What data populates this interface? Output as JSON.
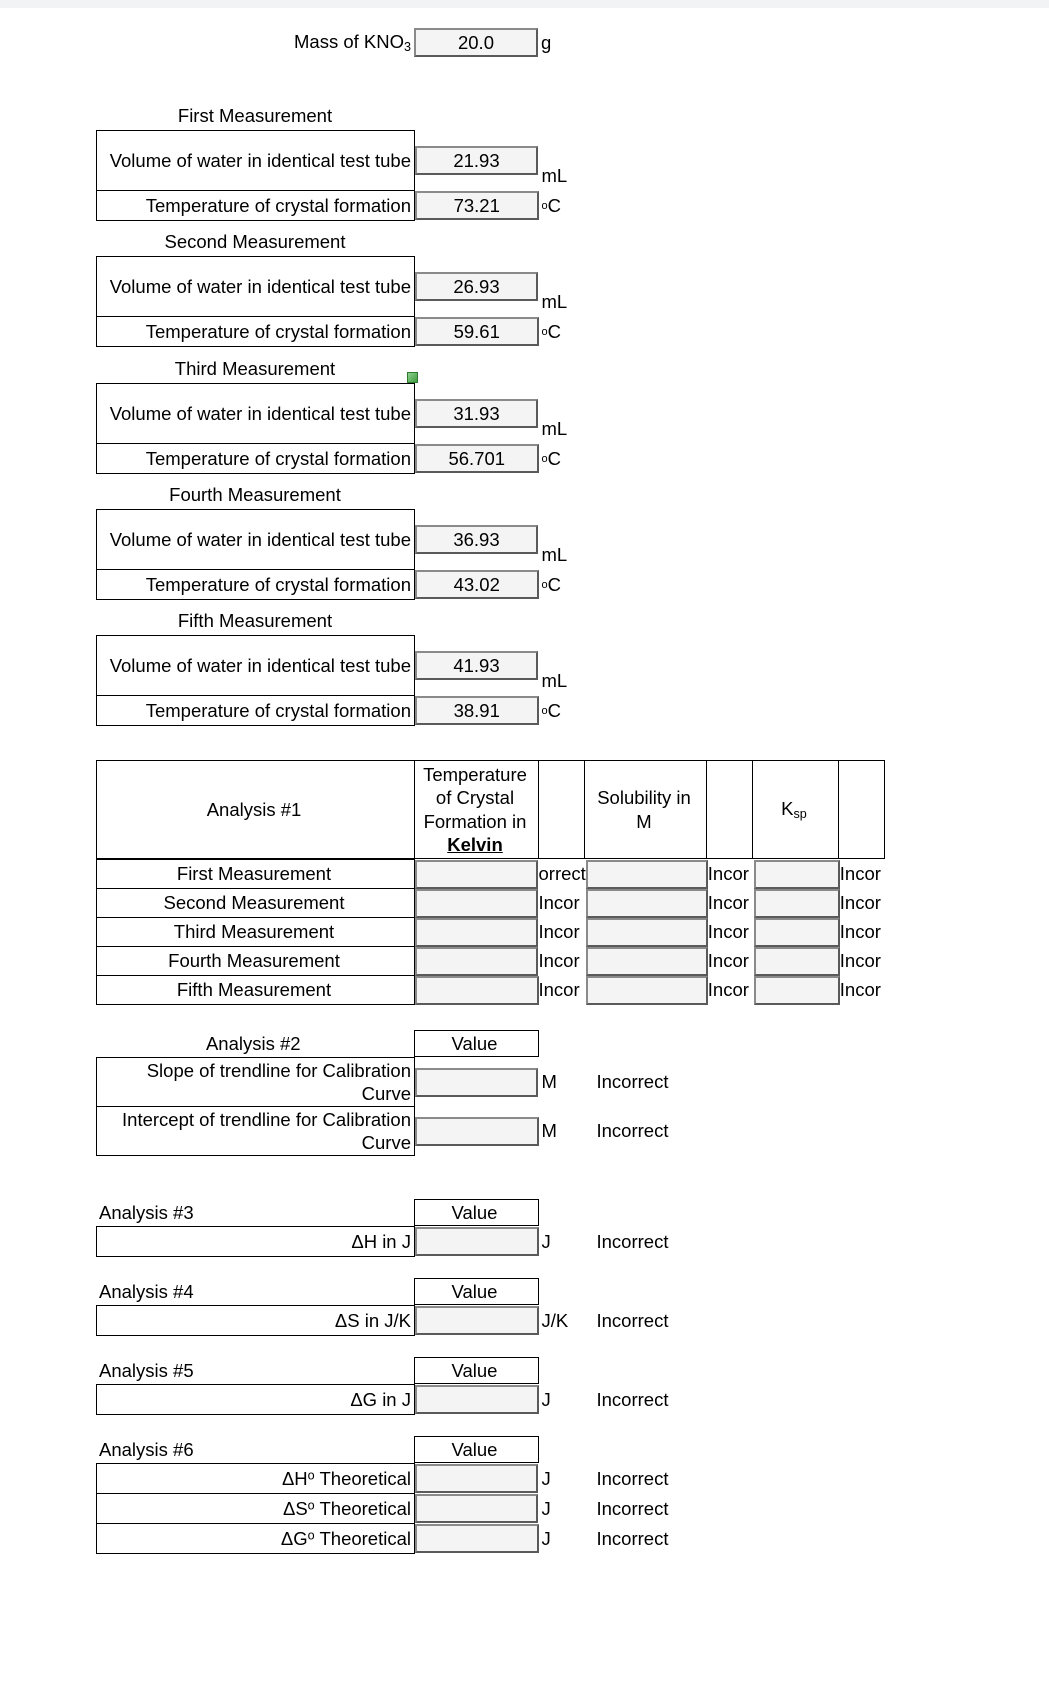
{
  "mass": {
    "label": "Mass of KNO",
    "label_sub": "3",
    "value": "20.0",
    "unit": "g"
  },
  "units": {
    "ml": "mL",
    "degc": "C",
    "deg": "o"
  },
  "measurements": [
    {
      "title": "First Measurement",
      "volume_label": "Volume of water in identical test tube",
      "volume_value": "21.93",
      "volume_unit": "mL",
      "temp_label": "Temperature of crystal formation",
      "temp_value": "73.21",
      "temp_unit": "C"
    },
    {
      "title": "Second Measurement",
      "volume_label": "Volume of water in identical test tube",
      "volume_value": "26.93",
      "volume_unit": "mL",
      "temp_label": "Temperature of crystal formation",
      "temp_value": "59.61",
      "temp_unit": "C"
    },
    {
      "title": "Third Measurement",
      "volume_label": "Volume of water in identical test tube",
      "volume_value": "31.93",
      "volume_unit": "mL",
      "temp_label": "Temperature of crystal formation",
      "temp_value": "56.701",
      "temp_unit": "C"
    },
    {
      "title": "Fourth Measurement",
      "volume_label": "Volume of water in identical test tube",
      "volume_value": "36.93",
      "volume_unit": "mL",
      "temp_label": "Temperature of crystal formation",
      "temp_value": "43.02",
      "temp_unit": "C"
    },
    {
      "title": "Fifth Measurement",
      "volume_label": "Volume of water in identical test tube",
      "volume_value": "41.93",
      "volume_unit": "mL",
      "temp_label": "Temperature of crystal formation",
      "temp_value": "38.91",
      "temp_unit": "C"
    }
  ],
  "analysis1": {
    "title": "Analysis #1",
    "headers": {
      "temp_line1": "Temperature",
      "temp_line2": "of Crystal",
      "temp_line3": "Formation in",
      "temp_line4": "Kelvin",
      "solubility_line1": "Solubility in",
      "solubility_line2": "M",
      "ksp": "K",
      "ksp_sub": "sp"
    },
    "rows": [
      {
        "label": "First Measurement",
        "temp_value": "",
        "temp_verdict": "orrect",
        "sol_value": "",
        "sol_verdict": "Incor",
        "ksp_value": "",
        "ksp_verdict": "Incor"
      },
      {
        "label": "Second Measurement",
        "temp_value": "",
        "temp_verdict": "Incor",
        "sol_value": "",
        "sol_verdict": "Incor",
        "ksp_value": "",
        "ksp_verdict": "Incor"
      },
      {
        "label": "Third Measurement",
        "temp_value": "",
        "temp_verdict": "Incor",
        "sol_value": "",
        "sol_verdict": "Incor",
        "ksp_value": "",
        "ksp_verdict": "Incor"
      },
      {
        "label": "Fourth Measurement",
        "temp_value": "",
        "temp_verdict": "Incor",
        "sol_value": "",
        "sol_verdict": "Incor",
        "ksp_value": "",
        "ksp_verdict": "Incor"
      },
      {
        "label": "Fifth Measurement",
        "temp_value": "",
        "temp_verdict": "Incor",
        "sol_value": "",
        "sol_verdict": "Incor",
        "ksp_value": "",
        "ksp_verdict": "Incor"
      }
    ]
  },
  "analysis2": {
    "title": "Analysis #2",
    "value_header": "Value",
    "rows": [
      {
        "label": "Slope of trendline for Calibration Curve",
        "value": "",
        "unit": "M",
        "verdict": "Incorrect"
      },
      {
        "label": "Intercept of trendline for Calibration Curve",
        "value": "",
        "unit": "M",
        "verdict": "Incorrect"
      }
    ]
  },
  "analysis3": {
    "title": "Analysis #3",
    "value_header": "Value",
    "rows": [
      {
        "label": "ΔH in J",
        "value": "",
        "unit": "J",
        "verdict": "Incorrect"
      }
    ]
  },
  "analysis4": {
    "title": "Analysis #4",
    "value_header": "Value",
    "rows": [
      {
        "label": "ΔS in J/K",
        "value": "",
        "unit": "J/K",
        "verdict": "Incorrect"
      }
    ]
  },
  "analysis5": {
    "title": "Analysis #5",
    "value_header": "Value",
    "rows": [
      {
        "label": "ΔG in J",
        "value": "",
        "unit": "J",
        "verdict": "Incorrect"
      }
    ]
  },
  "analysis6": {
    "title": "Analysis #6",
    "value_header": "Value",
    "rows": [
      {
        "label": "ΔH",
        "label_sup": "o",
        "label_rest": " Theoretical",
        "value": "",
        "unit": "J",
        "verdict": "Incorrect"
      },
      {
        "label": "ΔS",
        "label_sup": "o",
        "label_rest": " Theoretical",
        "value": "",
        "unit": "J",
        "verdict": "Incorrect"
      },
      {
        "label": "ΔG",
        "label_sup": "o",
        "label_rest": " Theoretical",
        "value": "",
        "unit": "J",
        "verdict": "Incorrect"
      }
    ]
  }
}
